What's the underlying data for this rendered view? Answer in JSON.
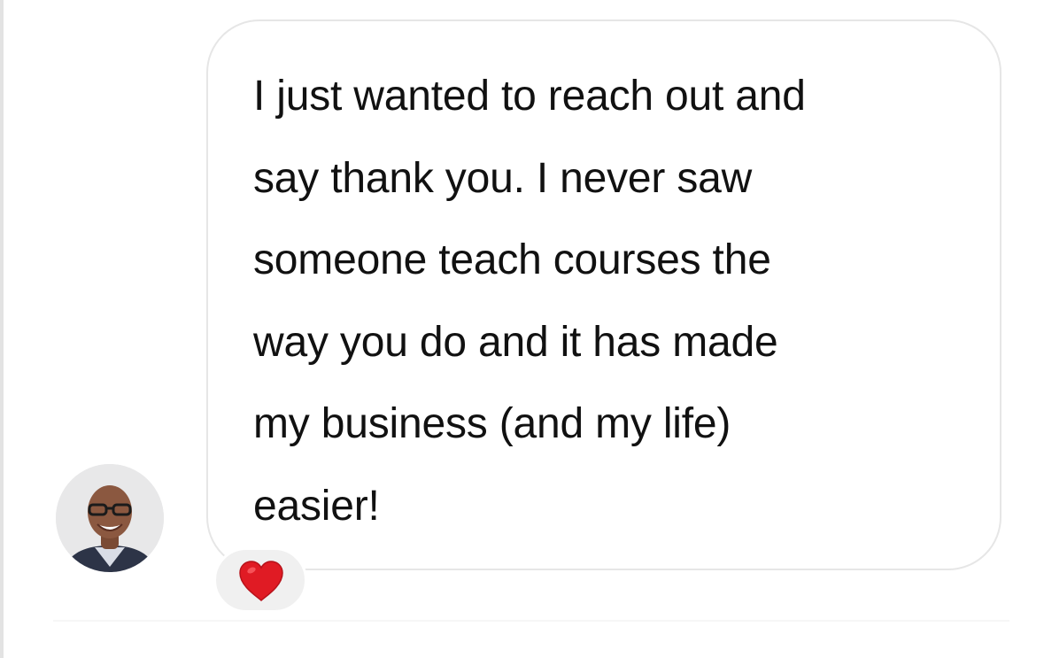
{
  "conversation": {
    "incoming_message": {
      "text": "I just wanted to reach out and\nsay thank you. I never saw\nsomeone teach courses the\nway you do and it has made\nmy business (and my life)\neasier!",
      "reaction_icon": "red-heart-icon"
    },
    "sender_avatar_icon": "profile-photo"
  },
  "colors": {
    "bubble_border": "#e6e6e6",
    "reaction_background": "#f0f0f0",
    "heart": "#e01b24",
    "text": "#111111"
  }
}
